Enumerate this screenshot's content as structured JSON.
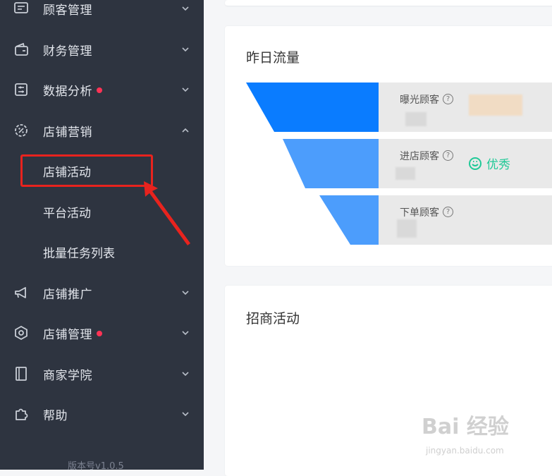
{
  "sidebar": {
    "menu": [
      {
        "label": "顾客管理",
        "icon": "message-icon",
        "has_dot": false,
        "expanded": false
      },
      {
        "label": "财务管理",
        "icon": "wallet-icon",
        "has_dot": false,
        "expanded": false
      },
      {
        "label": "数据分析",
        "icon": "analytics-icon",
        "has_dot": true,
        "expanded": false
      },
      {
        "label": "店铺营销",
        "icon": "discount-icon",
        "has_dot": false,
        "expanded": true
      },
      {
        "label": "店铺推广",
        "icon": "megaphone-icon",
        "has_dot": false,
        "expanded": false
      },
      {
        "label": "店铺管理",
        "icon": "settings-icon",
        "has_dot": true,
        "expanded": false
      },
      {
        "label": "商家学院",
        "icon": "book-icon",
        "has_dot": false,
        "expanded": false
      },
      {
        "label": "帮助",
        "icon": "puzzle-icon",
        "has_dot": false,
        "expanded": false
      }
    ],
    "sub_items": [
      "店铺活动",
      "平台活动",
      "批量任务列表"
    ],
    "version": "版本号v1.0.5",
    "dot_color": "#ff3355",
    "highlight_color": "#e8231e"
  },
  "flow_card": {
    "title": "昨日流量",
    "rows": [
      {
        "label": "曝光顾客",
        "color": "#0a7cff"
      },
      {
        "label": "进店顾客",
        "color": "#4c9dfc",
        "badge": "优秀"
      },
      {
        "label": "下单顾客",
        "color": "#4c9dfc"
      }
    ],
    "badge_color": "#20c997"
  },
  "promo_card": {
    "title": "招商活动"
  },
  "watermark": {
    "main": "Bai 经验",
    "sub": "jingyan.baidu.com"
  }
}
